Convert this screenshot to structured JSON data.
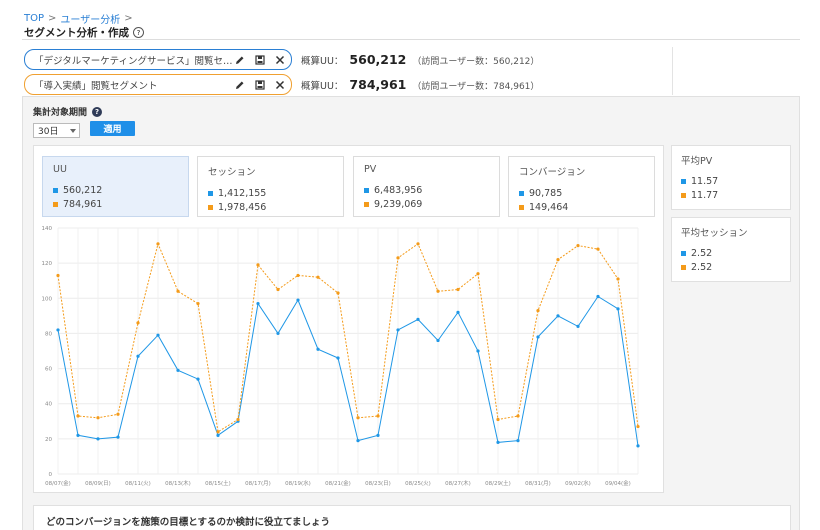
{
  "breadcrumb": {
    "items": [
      "TOP",
      "ユーザー分析"
    ],
    "sep": ">"
  },
  "page": {
    "title": "セグメント分析・作成",
    "help": "?"
  },
  "segments": [
    {
      "name": "「デジタルマーケティングサービス」閲覧セ…",
      "stat_label": "概算UU：",
      "stat_value": "560,212",
      "stat_sub": "（訪問ユーザー数：560,212）",
      "color": "#2a7fd4"
    },
    {
      "name": "「導入実績」閲覧セグメント",
      "stat_label": "概算UU：",
      "stat_value": "784,961",
      "stat_sub": "（訪問ユーザー数：784,961）",
      "color": "#f0a030"
    }
  ],
  "period": {
    "label": "集計対象期間",
    "info": "?",
    "selected": "30日",
    "apply_label": "適用"
  },
  "metrics": [
    {
      "name": "UU",
      "v1": "560,212",
      "v2": "784,961",
      "active": true
    },
    {
      "name": "セッション",
      "v1": "1,412,155",
      "v2": "1,978,456",
      "active": false
    },
    {
      "name": "PV",
      "v1": "6,483,956",
      "v2": "9,239,069",
      "active": false
    },
    {
      "name": "コンバージョン",
      "v1": "90,785",
      "v2": "149,464",
      "active": false
    }
  ],
  "side_metrics": [
    {
      "name": "平均PV",
      "v1": "11.57",
      "v2": "11.77"
    },
    {
      "name": "平均セッション",
      "v1": "2.52",
      "v2": "2.52"
    }
  ],
  "chart_data": {
    "type": "line",
    "ylim": [
      0,
      140
    ],
    "yticks": [
      0,
      20,
      40,
      60,
      80,
      100,
      120,
      140
    ],
    "grid": true,
    "x_tick_labels": [
      "08/07(金)",
      "08/09(日)",
      "08/11(火)",
      "08/13(木)",
      "08/15(土)",
      "08/17(月)",
      "08/19(水)",
      "08/21(金)",
      "08/23(日)",
      "08/25(火)",
      "08/27(木)",
      "08/29(土)",
      "08/31(月)",
      "09/02(水)",
      "09/04(金)"
    ],
    "series": [
      {
        "color": "#1f97e6",
        "style": "solid",
        "values": [
          82,
          22,
          20,
          21,
          67,
          79,
          59,
          54,
          22,
          30,
          97,
          80,
          99,
          71,
          66,
          19,
          22,
          82,
          88,
          76,
          92,
          70,
          18,
          19,
          78,
          90,
          84,
          101,
          94,
          16
        ]
      },
      {
        "color": "#f49b1a",
        "style": "dashed",
        "values": [
          113,
          33,
          32,
          34,
          86,
          131,
          104,
          97,
          24,
          31,
          119,
          105,
          113,
          112,
          103,
          32,
          33,
          123,
          131,
          104,
          105,
          114,
          31,
          33,
          93,
          122,
          130,
          128,
          111,
          27
        ]
      }
    ]
  },
  "bottom": {
    "text": "どのコンバージョンを施策の目標とするのか検討に役立てましょう"
  },
  "icons": {
    "edit": "pencil-icon",
    "save": "save-icon",
    "close": "close-icon"
  }
}
